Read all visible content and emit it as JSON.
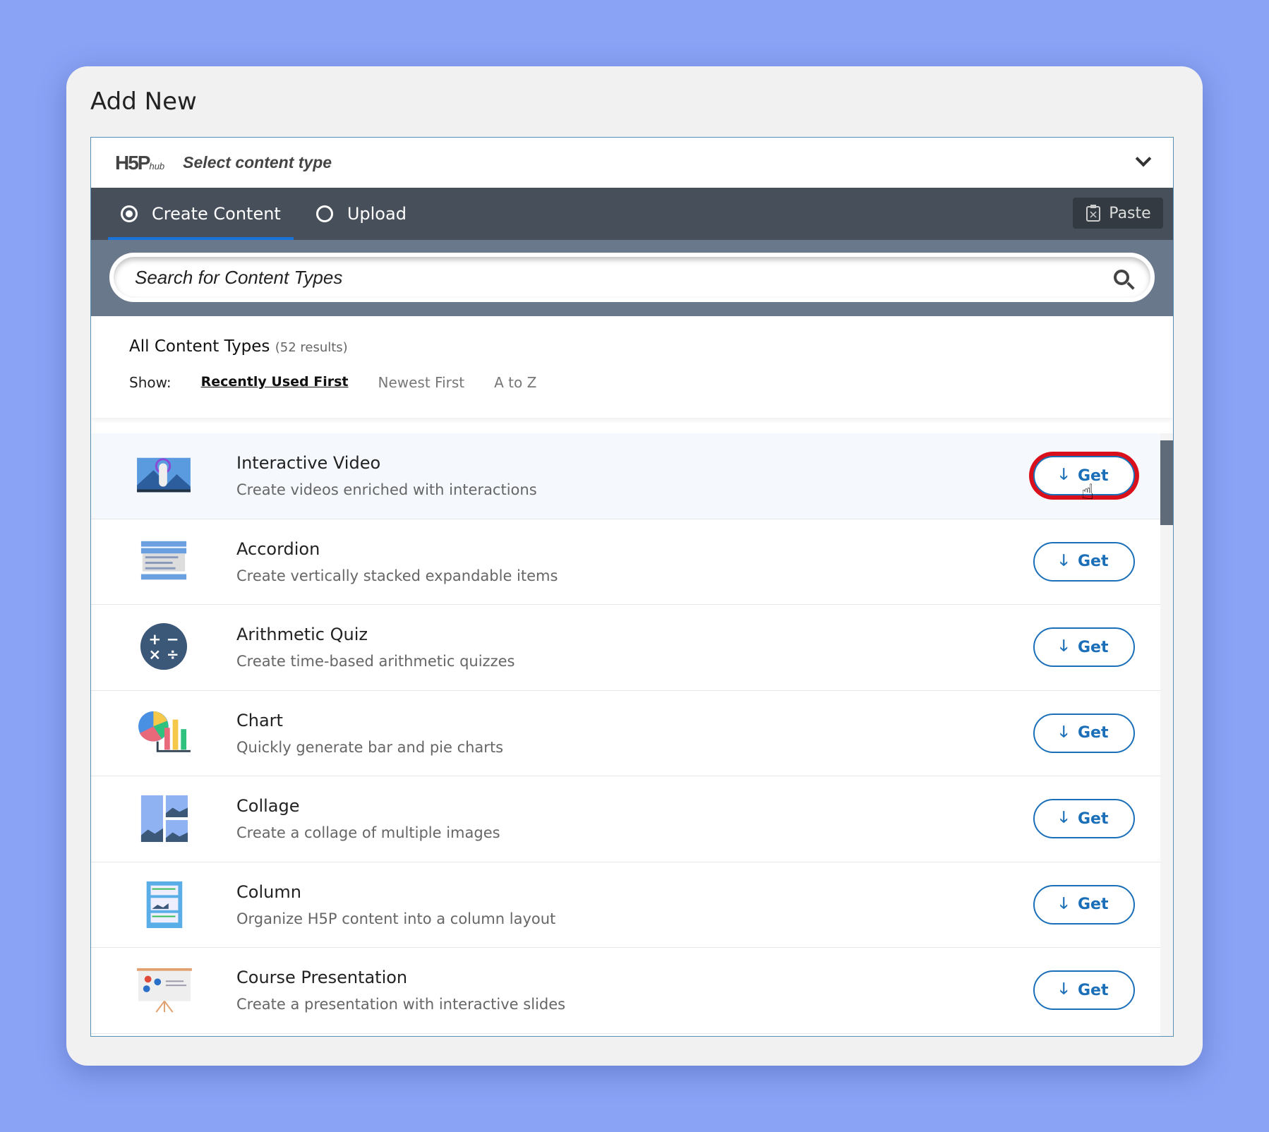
{
  "dialog_title": "Add New",
  "hub": {
    "logo": "H5P",
    "logo_sub": "hub",
    "select_label": "Select content type"
  },
  "tabs": [
    {
      "label": "Create Content",
      "selected": true
    },
    {
      "label": "Upload",
      "selected": false
    }
  ],
  "paste_label": "Paste",
  "search": {
    "placeholder": "Search for Content Types"
  },
  "heading": "All Content Types",
  "results": "(52 results)",
  "show": {
    "label": "Show:",
    "options": [
      "Recently Used First",
      "Newest First",
      "A to Z"
    ],
    "selected": "Recently Used First"
  },
  "get_label": "Get",
  "accent": "#1a6fb8",
  "highlight_ring": "#d90f1c",
  "items": [
    {
      "name": "Interactive Video",
      "desc": "Create videos enriched with interactions",
      "icon": "interactive-video-icon",
      "highlighted": true
    },
    {
      "name": "Accordion",
      "desc": "Create vertically stacked expandable items",
      "icon": "accordion-icon"
    },
    {
      "name": "Arithmetic Quiz",
      "desc": "Create time-based arithmetic quizzes",
      "icon": "arithmetic-quiz-icon"
    },
    {
      "name": "Chart",
      "desc": "Quickly generate bar and pie charts",
      "icon": "chart-icon"
    },
    {
      "name": "Collage",
      "desc": "Create a collage of multiple images",
      "icon": "collage-icon"
    },
    {
      "name": "Column",
      "desc": "Organize H5P content into a column layout",
      "icon": "column-icon"
    },
    {
      "name": "Course Presentation",
      "desc": "Create a presentation with interactive slides",
      "icon": "course-presentation-icon"
    }
  ]
}
